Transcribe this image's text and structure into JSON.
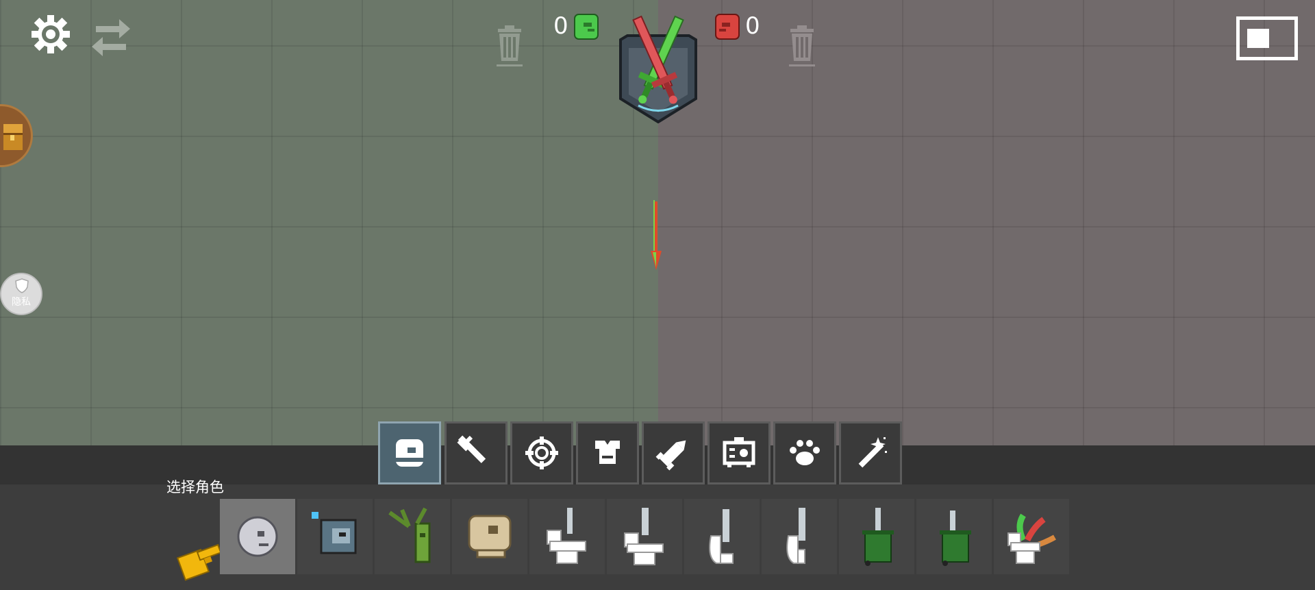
{
  "scores": {
    "green": "0",
    "red": "0"
  },
  "side_buttons": {
    "privacy_label": "隐私"
  },
  "categories": [
    {
      "name": "characters",
      "icon": "character-face-icon",
      "active": true
    },
    {
      "name": "melee-weapons",
      "icon": "sword-icon",
      "active": false
    },
    {
      "name": "firearms",
      "icon": "crosshair-icon",
      "active": false
    },
    {
      "name": "armor",
      "icon": "armor-icon",
      "active": false
    },
    {
      "name": "explosives",
      "icon": "rocket-icon",
      "active": false
    },
    {
      "name": "machines",
      "icon": "machine-icon",
      "active": false
    },
    {
      "name": "animals",
      "icon": "paw-icon",
      "active": false
    },
    {
      "name": "magic",
      "icon": "magic-wand-icon",
      "active": false
    }
  ],
  "panel": {
    "title": "选择角色"
  },
  "items": [
    {
      "name": "gray-ball-character",
      "selected": true
    },
    {
      "name": "robot-character"
    },
    {
      "name": "plant-character"
    },
    {
      "name": "skull-character"
    },
    {
      "name": "toilet-character-1"
    },
    {
      "name": "toilet-character-2"
    },
    {
      "name": "toilet-character-3"
    },
    {
      "name": "toilet-character-4"
    },
    {
      "name": "trashcan-character-1"
    },
    {
      "name": "trashcan-character-2"
    },
    {
      "name": "toilet-worm-character"
    }
  ],
  "colors": {
    "green_team": "#4cc94c",
    "red_team": "#d9443f",
    "accent_active_tab": "#4d6470",
    "hand_pointer": "#f2b70d"
  }
}
